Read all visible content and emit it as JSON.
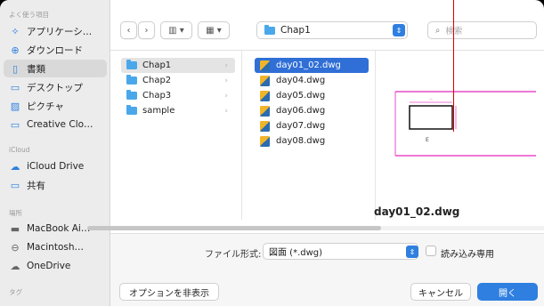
{
  "sidebar": {
    "favorites_header": "よく使う項目",
    "favorites": [
      {
        "label": "アプリケーシ…",
        "icon": "applications-icon"
      },
      {
        "label": "ダウンロード",
        "icon": "download-icon"
      },
      {
        "label": "書類",
        "icon": "documents-icon"
      },
      {
        "label": "デスクトップ",
        "icon": "desktop-icon"
      },
      {
        "label": "ピクチャ",
        "icon": "pictures-icon"
      },
      {
        "label": "Creative Clo…",
        "icon": "folder-icon"
      }
    ],
    "icloud_header": "iCloud",
    "icloud": [
      {
        "label": "iCloud Drive",
        "icon": "cloud-icon"
      },
      {
        "label": "共有",
        "icon": "shared-folder-icon"
      }
    ],
    "locations_header": "場所",
    "locations": [
      {
        "label": "MacBook Ai…",
        "icon": "laptop-icon"
      },
      {
        "label": "Macintosh…",
        "icon": "disk-icon"
      },
      {
        "label": "OneDrive",
        "icon": "cloud-icon"
      }
    ],
    "tags_header": "タグ"
  },
  "toolbar": {
    "location": "Chap1",
    "search_placeholder": "検索"
  },
  "columns": {
    "folders": [
      "Chap1",
      "Chap2",
      "Chap3",
      "sample"
    ],
    "files": [
      "day01_02.dwg",
      "day04.dwg",
      "day05.dwg",
      "day06.dwg",
      "day07.dwg",
      "day08.dwg"
    ]
  },
  "preview": {
    "filename": "day01_02.dwg",
    "drawing_label": "E"
  },
  "bottom": {
    "format_label": "ファイル形式:",
    "format_value": "図面 (*.dwg)",
    "readonly_label": "読み込み専用",
    "options_button": "オプションを非表示",
    "cancel_button": "キャンセル",
    "open_button": "開く"
  },
  "colors": {
    "accent": "#2f7fe0",
    "selection": "#2f6fd6",
    "drawing_magenta": "#e84cc8"
  }
}
